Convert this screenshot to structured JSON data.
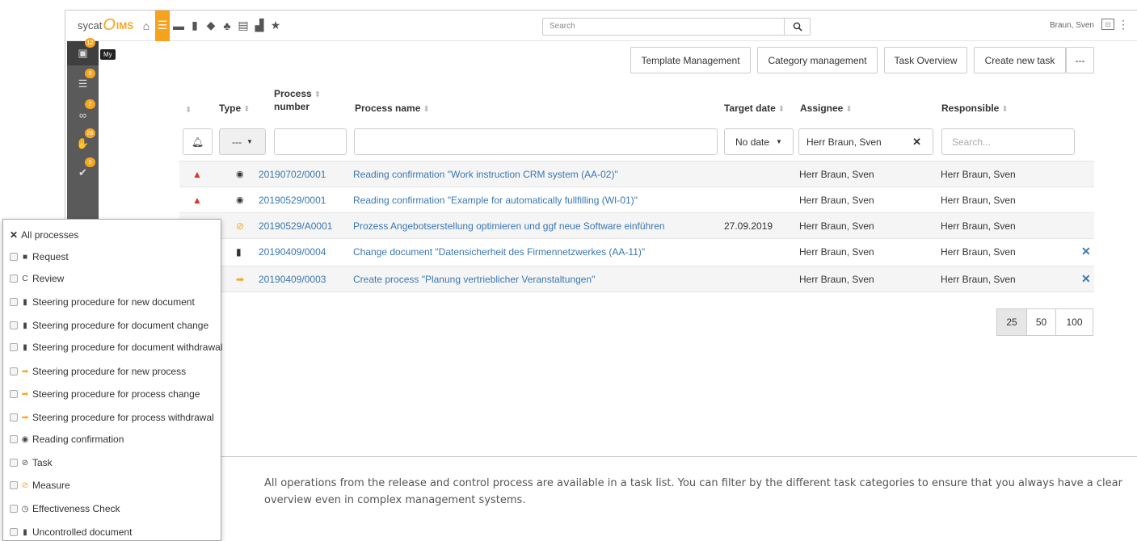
{
  "topbar": {
    "logo_word": "sycat",
    "logo_o": "O",
    "logo_ims": "IMS",
    "search_placeholder": "Search",
    "user_name": "Braun, Sven",
    "nav_icons": [
      "home-icon",
      "task-list-icon",
      "cards-icon",
      "document-icon",
      "graduation-cap-icon",
      "org-chart-icon",
      "copy-icon",
      "bar-chart-icon",
      "star-icon"
    ]
  },
  "leftbar": {
    "tooltip": "My",
    "items": [
      {
        "icon": "save-icon",
        "badge": "12"
      },
      {
        "icon": "checklist-icon",
        "badge": "8"
      },
      {
        "icon": "glasses-icon",
        "badge": "2"
      },
      {
        "icon": "thumbs-icon",
        "badge": "26"
      },
      {
        "icon": "check-circle-icon",
        "badge": "5"
      }
    ]
  },
  "actions": {
    "template_management": "Template Management",
    "category_management": "Category management",
    "task_overview": "Task Overview",
    "create_new_task": "Create new task",
    "more": "---"
  },
  "table": {
    "headers": {
      "type": "Type",
      "process_number_1": "Process",
      "process_number_2": "number",
      "process_name": "Process name",
      "target_date": "Target date",
      "assignee": "Assignee",
      "responsible": "Responsible"
    },
    "filters": {
      "type_value": "---",
      "target_date_value": "No date",
      "assignee_value": "Herr Braun, Sven",
      "responsible_placeholder": "Search..."
    },
    "rows": [
      {
        "number": "20190702/0001",
        "name": "Reading confirmation \"Work instruction CRM system (AA-02)\"",
        "target_date": "",
        "assignee": "Herr Braun, Sven",
        "responsible": "Herr Braun, Sven"
      },
      {
        "number": "20190529/0001",
        "name": "Reading confirmation \"Example for automatically fullfilling (WI-01)\"",
        "target_date": "",
        "assignee": "Herr Braun, Sven",
        "responsible": "Herr Braun, Sven"
      },
      {
        "number": "20190529/A0001",
        "name": "Prozess Angebotserstellung optimieren und ggf neue Software einführen",
        "target_date": "27.09.2019",
        "assignee": "Herr Braun, Sven",
        "responsible": "Herr Braun, Sven"
      },
      {
        "number": "20190409/0004",
        "name": "Change document \"Datensicherheit des Firmennetzwerkes (AA-11)\"",
        "target_date": "",
        "assignee": "Herr Braun, Sven",
        "responsible": "Herr Braun, Sven"
      },
      {
        "number": "20190409/0003",
        "name": "Create process \"Planung vertrieblicher Veranstaltungen\"",
        "target_date": "",
        "assignee": "Herr Braun, Sven",
        "responsible": "Herr Braun, Sven"
      }
    ]
  },
  "pagination": [
    "25",
    "50",
    "100"
  ],
  "dropdown": {
    "all": "All processes",
    "items": [
      "Request",
      "Review",
      "Steering procedure for new document",
      "Steering procedure for document change",
      "Steering procedure for document withdrawal",
      "Steering procedure for new process",
      "Steering procedure for process change",
      "Steering procedure for process withdrawal",
      "Reading confirmation",
      "Task",
      "Measure",
      "Effectiveness Check",
      "Uncontrolled document"
    ]
  },
  "caption": "All operations from the release and control process are available in a task list. You can filter by the different task categories to ensure that you always have a clear overview even in complex management systems."
}
